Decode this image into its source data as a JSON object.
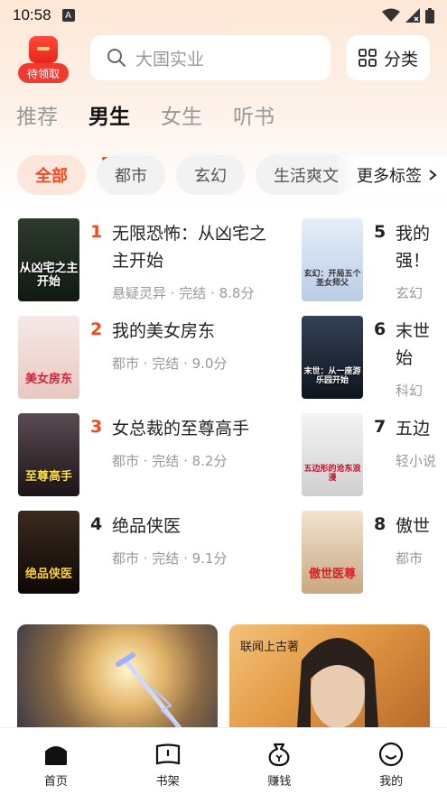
{
  "status": {
    "time": "10:58",
    "app_indicator": "A"
  },
  "header": {
    "gift_label": "待领取",
    "search_placeholder": "大国实业",
    "category_label": "分类"
  },
  "tabs": [
    "推荐",
    "男生",
    "女生",
    "听书"
  ],
  "chips": [
    "全部",
    "都市",
    "玄幻",
    "生活爽文"
  ],
  "more_tags": "更多标签",
  "books_left": [
    {
      "rank": "1",
      "title_line1": "无限恐怖：从凶宅之",
      "title_line2": "主开始",
      "meta": "悬疑灵异 · 完结 · 8.8分",
      "cover_text": "从凶宅之主开始"
    },
    {
      "rank": "2",
      "title_line1": "我的美女房东",
      "meta": "都市 · 完结 · 9.0分",
      "cover_text": "美女房东"
    },
    {
      "rank": "3",
      "title_line1": "女总裁的至尊高手",
      "meta": "都市 · 完结 · 8.2分",
      "cover_text": "至尊高手"
    },
    {
      "rank": "4",
      "title_line1": "绝品侠医",
      "meta": "都市 · 完结 · 9.1分",
      "cover_text": "绝品侠医"
    }
  ],
  "books_right": [
    {
      "rank": "5",
      "title_line1": "我的",
      "title_line2": "强！",
      "meta": "玄幻",
      "cover_text": "玄幻：开局五个圣女师父"
    },
    {
      "rank": "6",
      "title_line1": "末世",
      "title_line2": "始",
      "meta": "科幻",
      "cover_text": "末世：从一座游乐园开始"
    },
    {
      "rank": "7",
      "title_line1": "五边",
      "meta": "轻小说",
      "cover_text": "五边形的沧东浪漫"
    },
    {
      "rank": "8",
      "title_line1": "傲世",
      "meta": "都市",
      "cover_text": "傲世医尊"
    }
  ],
  "banners": [
    {
      "caption": ""
    },
    {
      "caption": "联闻上古著"
    }
  ],
  "bottom_nav": [
    "首页",
    "书架",
    "赚钱",
    "我的"
  ],
  "colors": {
    "accent": "#f04a1e",
    "gift": "#f23a2e"
  }
}
